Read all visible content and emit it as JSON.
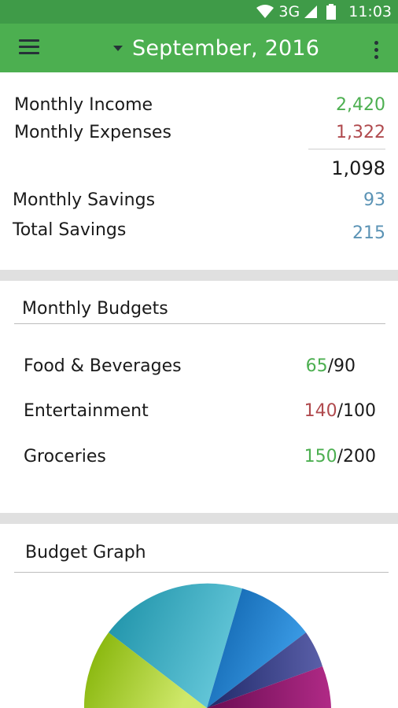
{
  "status_bar": {
    "network": "3G",
    "time": "11:03",
    "icons": [
      "wifi-icon",
      "signal-icon",
      "battery-icon"
    ]
  },
  "app_bar": {
    "title": "September, 2016",
    "menu_icon": "hamburger-menu-icon",
    "dropdown_icon": "caret-down-icon",
    "overflow_icon": "more-vert-icon"
  },
  "summary": {
    "income_label": "Monthly Income",
    "income_value": "2,420",
    "expenses_label": "Monthly Expenses",
    "expenses_value": "1,322",
    "net_value": "1,098",
    "monthly_savings_label": "Monthly Savings",
    "monthly_savings_value": "93",
    "total_savings_label": "Total Savings",
    "total_savings_value": "215"
  },
  "budgets": {
    "heading": "Monthly Budgets",
    "items": [
      {
        "label": "Food & Beverages",
        "spent": "65",
        "limit": "/90",
        "status": "under"
      },
      {
        "label": "Entertainment",
        "spent": "140",
        "limit": "/100",
        "status": "over"
      },
      {
        "label": "Groceries",
        "spent": "150",
        "limit": "/200",
        "status": "under"
      }
    ]
  },
  "graph": {
    "heading": "Budget Graph"
  },
  "colors": {
    "status_bar": "#3f9b48",
    "app_bar": "#4caf50",
    "positive": "#4caf50",
    "negative": "#b04a4e",
    "savings": "#5b93b5",
    "separator": "#e0e0e0"
  }
}
